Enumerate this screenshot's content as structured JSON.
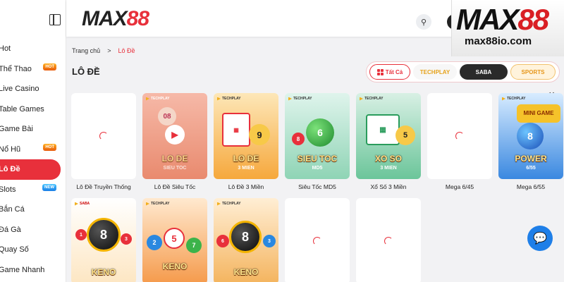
{
  "nav": {
    "items": [
      {
        "label": "Hot",
        "badge": ""
      },
      {
        "label": "Thể Thao",
        "badge": "HOT"
      },
      {
        "label": "Live Casino",
        "badge": ""
      },
      {
        "label": "Table Games",
        "badge": ""
      },
      {
        "label": "Game Bài",
        "badge": ""
      },
      {
        "label": "Nổ Hũ",
        "badge": "HOT"
      },
      {
        "label": "Lô Đề",
        "badge": ""
      },
      {
        "label": "Slots",
        "badge": "NEW"
      },
      {
        "label": "Bắn Cá",
        "badge": ""
      },
      {
        "label": "Đá Gà",
        "badge": ""
      },
      {
        "label": "Quay Số",
        "badge": ""
      },
      {
        "label": "Game Nhanh",
        "badge": ""
      }
    ],
    "active_index": 6
  },
  "header": {
    "logo_text": "MAX",
    "logo_accent": "88"
  },
  "brand": {
    "logo_text": "MAX",
    "logo_accent": "88",
    "url": "max88io.com"
  },
  "breadcrumb": {
    "home": "Trang chủ",
    "separator": ">",
    "current": "Lô Đề"
  },
  "section_title": "LÔ ĐỀ",
  "providers": {
    "all": "Tất Cả",
    "techplay": "TECHPLAY",
    "saba": "SABA",
    "sports": "SPORTS"
  },
  "games": [
    {
      "label": "Lô Đề Truyền Thống",
      "loading": true
    },
    {
      "label": "Lô Đề Siêu Tốc",
      "loading": false,
      "provider": "TECHPLAY",
      "title": "LO DE",
      "sub": "SIEU TOC"
    },
    {
      "label": "Lô Đề 3 Miền",
      "loading": false,
      "provider": "TECHPLAY",
      "title": "LO DE",
      "sub": "3 MIEN"
    },
    {
      "label": "Siêu Tốc MD5",
      "loading": false,
      "provider": "TECHPLAY",
      "title": "SIEU TOC",
      "sub": "MD5"
    },
    {
      "label": "Xổ Số 3 Miền",
      "loading": false,
      "provider": "TECHPLAY",
      "title": "XO SO",
      "sub": "3 MIEN"
    },
    {
      "label": "Mega 6/45",
      "loading": true
    },
    {
      "label": "Mega 6/55",
      "loading": false,
      "provider": "TECHPLAY",
      "title": "POWER",
      "sub": "6/55",
      "badge": "MINI GAME"
    },
    {
      "label": "",
      "loading": false,
      "provider": "SABA",
      "title": "KENO"
    },
    {
      "label": "",
      "loading": false,
      "provider": "TECHPLAY",
      "title": "KENO"
    },
    {
      "label": "",
      "loading": false,
      "provider": "TECHPLAY",
      "title": "KENO"
    },
    {
      "label": "",
      "loading": true
    },
    {
      "label": "",
      "loading": true
    }
  ],
  "colors": {
    "accent": "#e8303b",
    "chat": "#1f7fe8"
  },
  "icons": {
    "search": "search-icon",
    "chat": "chat-icon",
    "collapse": "sidebar-collapse-icon",
    "close": "close-icon"
  }
}
